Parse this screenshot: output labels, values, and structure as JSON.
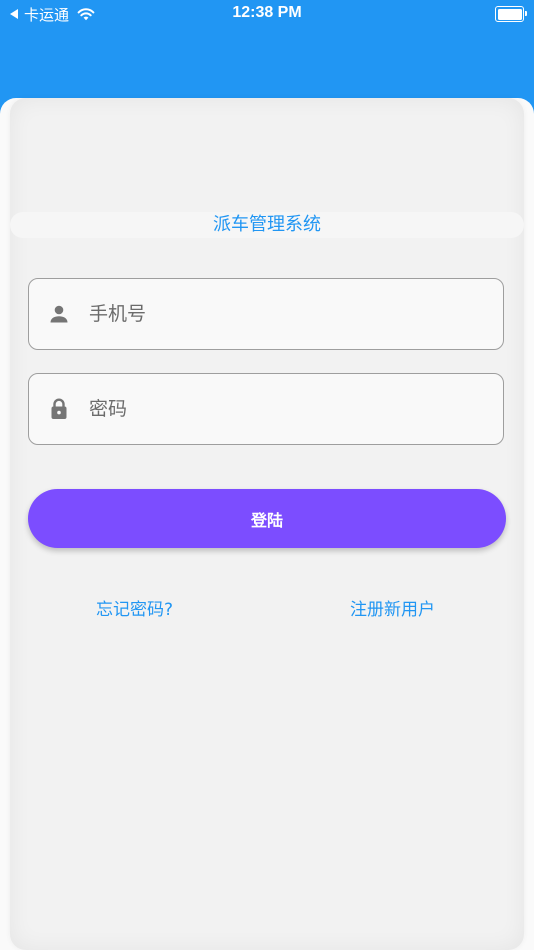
{
  "status_bar": {
    "carrier": "卡运通",
    "time": "12:38 PM"
  },
  "login": {
    "system_title": "派车管理系统",
    "phone_placeholder": "手机号",
    "password_placeholder": "密码",
    "login_label": "登陆",
    "forgot_password_label": "忘记密码?",
    "register_label": "注册新用户"
  },
  "colors": {
    "primary_blue": "#2196f3",
    "button_purple": "#7c4dff",
    "card_background": "#f2f2f2",
    "field_border": "#9e9e9e",
    "icon_gray": "#757575"
  },
  "icons": {
    "phone_field": "person-icon",
    "password_field": "lock-icon"
  }
}
